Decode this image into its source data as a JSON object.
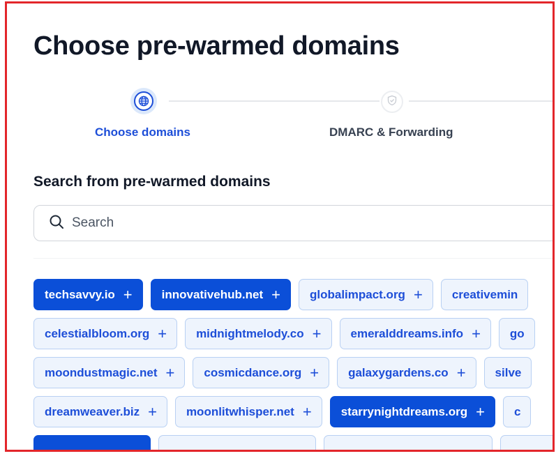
{
  "header": {
    "title": "Choose pre-warmed domains"
  },
  "stepper": {
    "steps": [
      {
        "label": "Choose domains",
        "state": "active",
        "icon": "globe-icon"
      },
      {
        "label": "DMARC & Forwarding",
        "state": "inactive",
        "icon": "shield-check-icon"
      }
    ]
  },
  "search": {
    "section_title": "Search from pre-warmed domains",
    "placeholder": "Search",
    "value": ""
  },
  "domains": {
    "rows": [
      [
        {
          "name": "techsavvy.io",
          "selected": true
        },
        {
          "name": "innovativehub.net",
          "selected": true
        },
        {
          "name": "globalimpact.org",
          "selected": false
        },
        {
          "name": "creativemin",
          "selected": false
        }
      ],
      [
        {
          "name": "celestialbloom.org",
          "selected": false
        },
        {
          "name": "midnightmelody.co",
          "selected": false
        },
        {
          "name": "emeralddreams.info",
          "selected": false
        },
        {
          "name": "go",
          "selected": false
        }
      ],
      [
        {
          "name": "moondustmagic.net",
          "selected": false
        },
        {
          "name": "cosmicdance.org",
          "selected": false
        },
        {
          "name": "galaxygardens.co",
          "selected": false
        },
        {
          "name": "silve",
          "selected": false
        }
      ],
      [
        {
          "name": "dreamweaver.biz",
          "selected": false
        },
        {
          "name": "moonlitwhisper.net",
          "selected": false
        },
        {
          "name": "starrynightdreams.org",
          "selected": true
        },
        {
          "name": "c",
          "selected": false
        }
      ],
      [
        {
          "name": "",
          "selected": true
        },
        {
          "name": "",
          "selected": false
        },
        {
          "name": "",
          "selected": false
        },
        {
          "name": "",
          "selected": false
        }
      ]
    ],
    "add_symbol": "+"
  },
  "colors": {
    "accent": "#0b4fd8",
    "chip_bg": "#eef4fd",
    "chip_border": "#b8d0f3",
    "frame_border": "#e3262b",
    "title": "#111827"
  }
}
